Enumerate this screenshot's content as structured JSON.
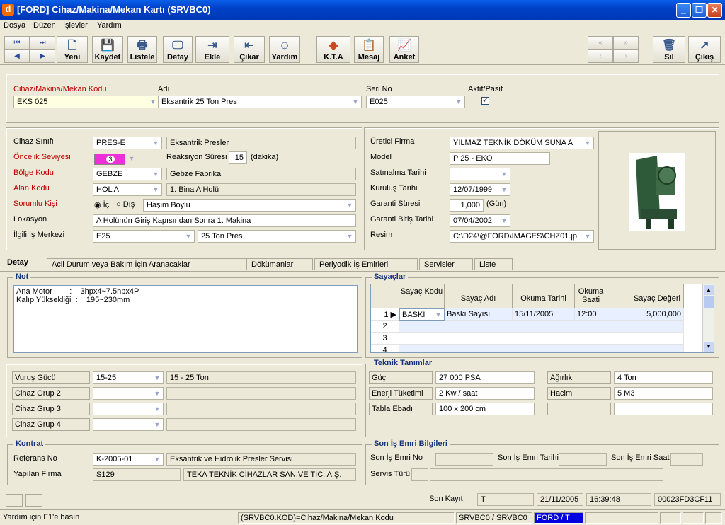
{
  "window": {
    "title": "[FORD] Cihaz/Makina/Mekan Kartı (SRVBC0)",
    "app_letter": "d"
  },
  "menu": [
    "Dosya",
    "Düzen",
    "İşlevler",
    "Yardım"
  ],
  "toolbar": {
    "yeni": "Yeni",
    "kaydet": "Kaydet",
    "listele": "Listele",
    "detay": "Detay",
    "ekle": "Ekle",
    "cikar": "Çıkar",
    "yardim": "Yardım",
    "kta": "K.T.A",
    "mesaj": "Mesaj",
    "anket": "Anket",
    "sil": "Sil",
    "cikis": "Çıkış"
  },
  "header": {
    "code_label": "Cihaz/Makina/Mekan Kodu",
    "code_value": "EKS  025",
    "name_label": "Adı",
    "name_value": "Eksantrik 25 Ton Pres",
    "serial_label": "Seri No",
    "serial_value": "E025",
    "active_label": "Aktif/Pasif",
    "active_checked": "✓"
  },
  "left": {
    "sinif_label": "Cihaz Sınıfı",
    "sinif_code": "PRES-E",
    "sinif_desc": "Eksantrik Presler",
    "oncelik_label": "Öncelik Seviyesi",
    "oncelik_value": "3",
    "reaksiyon_label": "Reaksiyon Süresi",
    "reaksiyon_value": "15",
    "reaksiyon_unit": "(dakika)",
    "bolge_label": "Bölge Kodu",
    "bolge_code": "GEBZE",
    "bolge_desc": "Gebze Fabrika",
    "alan_label": "Alan Kodu",
    "alan_code": "HOL A",
    "alan_desc": "1. Bina A Holü",
    "sorumlu_label": "Sorumlu Kişi",
    "ic_label": "İç",
    "dis_label": "Dış",
    "sorumlu_value": "Haşim Boylu",
    "lokasyon_label": "Lokasyon",
    "lokasyon_value": "A Holünün Giriş Kapısından Sonra 1. Makina",
    "isMerkezi_label": "İlgili İş Merkezi",
    "isMerkezi_code": "E25",
    "isMerkezi_desc": "25 Ton Pres"
  },
  "right": {
    "uretici_label": "Üretici Firma",
    "uretici_value": "YILMAZ TEKNİK DÖKÜM SUNA A",
    "model_label": "Model",
    "model_value": "P 25 - EKO",
    "satinalma_label": "Satınalma Tarihi",
    "satinalma_value": "",
    "kurulus_label": "Kuruluş Tarihi",
    "kurulus_value": "12/07/1999",
    "garanti_label": "Garanti Süresi",
    "garanti_value": "1,000",
    "garanti_unit": "(Gün)",
    "garantiBitis_label": "Garanti Bitiş Tarihi",
    "garantiBitis_value": "07/04/2002",
    "resim_label": "Resim",
    "resim_value": "C:\\D24\\@FORD\\IMAGES\\CHZ01.jp"
  },
  "tabs": [
    "Detay",
    "Acil Durum veya Bakım İçin Aranacaklar",
    "Dökümanlar",
    "Periyodik İş Emirleri",
    "Servisler",
    "Liste"
  ],
  "not": {
    "title": "Not",
    "line1": "Ana Motor        :    3hpx4~7.5hpx4P",
    "line2": "Kalıp Yüksekliği  :    195~230mm"
  },
  "sayaclar": {
    "title": "Sayaçlar",
    "headers": [
      "Sayaç Kodu",
      "Sayaç Adı",
      "Okuma Tarihi",
      "Okuma Saati",
      "Sayaç Değeri"
    ],
    "rows": [
      {
        "no": "1",
        "kod": "BASKI",
        "ad": "Baskı Sayısı",
        "tarih": "15/11/2005",
        "saat": "12:00",
        "deger": "5,000,000"
      },
      {
        "no": "2",
        "kod": "",
        "ad": "",
        "tarih": "",
        "saat": "",
        "deger": ""
      },
      {
        "no": "3",
        "kod": "",
        "ad": "",
        "tarih": "",
        "saat": "",
        "deger": ""
      },
      {
        "no": "4",
        "kod": "",
        "ad": "",
        "tarih": "",
        "saat": "",
        "deger": ""
      }
    ]
  },
  "extra": {
    "vurus_label": "Vuruş Gücü",
    "vurus_code": "15-25",
    "vurus_desc": "15 - 25 Ton",
    "grup2_label": "Cihaz Grup 2",
    "grup3_label": "Cihaz Grup 3",
    "grup4_label": "Cihaz Grup 4"
  },
  "teknik": {
    "title": "Teknik Tanımlar",
    "guc_label": "Güç",
    "guc_value": "27 000 PSA",
    "enerji_label": "Enerji Tüketimi",
    "enerji_value": "2 Kw / saat",
    "tabla_label": "Tabla Ebadı",
    "tabla_value": "100 x 200 cm",
    "agirlik_label": "Ağırlık",
    "agirlik_value": "4 Ton",
    "hacim_label": "Hacim",
    "hacim_value": "5 M3"
  },
  "kontrat": {
    "title": "Kontrat",
    "referans_label": "Referans No",
    "referans_code": "K-2005-01",
    "referans_desc": "Eksantrik ve Hidrolik Presler Servisi",
    "firma_label": "Yapılan Firma",
    "firma_code": "S129",
    "firma_desc": "TEKA TEKNİK CİHAZLAR SAN.VE TİC. A.Ş."
  },
  "sonIs": {
    "title": "Son İş Emri Bilgileri",
    "no_label": "Son İş Emri No",
    "tarih_label": "Son İş Emri Tarihi",
    "saat_label": "Son İş Emri Saati",
    "servis_label": "Servis Türü"
  },
  "sonKayit": {
    "label": "Son Kayıt",
    "user": "T",
    "date": "21/11/2005",
    "time": "16:39:48",
    "id": "00023FD3CF11"
  },
  "status": {
    "help": "Yardım için F1'e basın",
    "field": "(SRVBC0.KOD)=Cihaz/Makina/Mekan Kodu",
    "form": "SRVBC0 / SRVBC0",
    "user": "FORD / T"
  }
}
